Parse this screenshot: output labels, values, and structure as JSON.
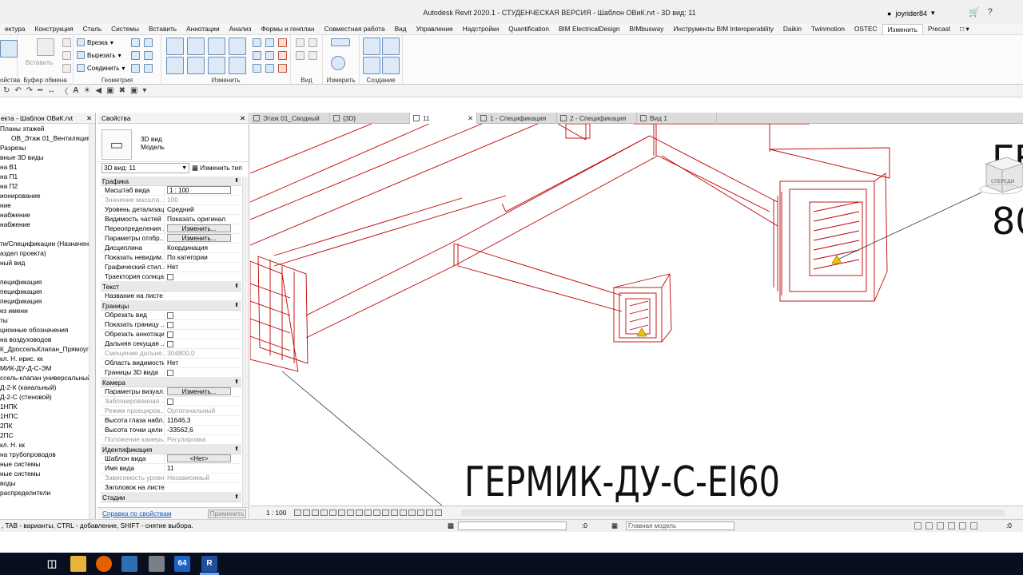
{
  "window": {
    "title": "Autodesk Revit 2020.1 - СТУДЕНЧЕСКАЯ ВЕРСИЯ - Шаблон ОВиК.rvt - 3D вид: 11",
    "user": "joyrider84"
  },
  "ribbon": {
    "tabs": [
      "ектура",
      "Конструкция",
      "Сталь",
      "Системы",
      "Вставить",
      "Аннотации",
      "Анализ",
      "Формы и генплан",
      "Совместная работа",
      "Вид",
      "Управление",
      "Надстройки",
      "Quantification",
      "BIM ElectricalDesign",
      "BIMbusway",
      "Инструменты BIM Interoperability",
      "Daikin",
      "Twinmotion",
      "OSTEC",
      "Изменить",
      "Precast"
    ],
    "active_tab": "Изменить",
    "panels": {
      "properties_label": "ойства",
      "clipboard": {
        "label": "Буфер обмена",
        "paste": "Вставить"
      },
      "geometry": {
        "label": "Геометрия",
        "cut": "Врезка",
        "cutout": "Вырезать",
        "join": "Соединить"
      },
      "modify": {
        "label": "Изменить"
      },
      "view": {
        "label": "Вид"
      },
      "measure": {
        "label": "Измерить"
      },
      "create": {
        "label": "Создание"
      }
    }
  },
  "browser": {
    "title": "екта - Шаблон ОВиК.rvt",
    "items": [
      "Планы этажей",
      "ОВ_Этаж 01_Вентиляция",
      "Разрезы",
      "вные 3D виды",
      "на В1",
      "на П1",
      "на П2",
      "ионирование",
      "ние",
      "набжение",
      "набжение",
      "",
      "ти/Спецификации (Назначение",
      "аздел проекта)",
      "ный вид",
      "",
      "пецификация",
      "пецификация",
      "пецификация",
      "ез имени",
      "ты",
      "ционные обозначения",
      "на воздуховодов",
      "К_ДроссельКлапан_Прямоугол",
      "кл. Н. ирис. кк",
      "МИК-ДУ-Д-С-ЭМ",
      "ссель-клапан универсальный в",
      "Д-2-К (канальный)",
      "Д-2-С (стеновой)",
      "1НПК",
      "1НПС",
      "2ПК",
      "2ПС",
      "кл. Н. кк",
      "на трубопроводов",
      "ные системы",
      "ные системы",
      "воды",
      "распределители"
    ]
  },
  "properties": {
    "title": "Свойства",
    "type_line1": "3D вид",
    "type_line2": "Модель",
    "selector": "3D вид: 11",
    "edit_type": "Изменить тип",
    "rows": [
      {
        "section": "Графика"
      },
      {
        "k": "Масштаб вида",
        "v": "1 : 100",
        "input": true
      },
      {
        "k": "Значение масшта...",
        "v": "100",
        "dis": true
      },
      {
        "k": "Уровень детализац...",
        "v": "Средний"
      },
      {
        "k": "Видимость частей",
        "v": "Показать оригинал"
      },
      {
        "k": "Переопределения ...",
        "v": "Изменить...",
        "btn": true
      },
      {
        "k": "Параметры отобр...",
        "v": "Изменить...",
        "btn": true
      },
      {
        "k": "Дисциплина",
        "v": "Координация"
      },
      {
        "k": "Показать невидим...",
        "v": "По категории"
      },
      {
        "k": "Графический стил...",
        "v": "Нет"
      },
      {
        "k": "Траектория солнца",
        "chk": true
      },
      {
        "section": "Текст"
      },
      {
        "k": "Название на листе",
        "v": ""
      },
      {
        "section": "Границы"
      },
      {
        "k": "Обрезать вид",
        "chk": true
      },
      {
        "k": "Показать границу ...",
        "chk": true
      },
      {
        "k": "Обрезать аннотации",
        "chk": true
      },
      {
        "k": "Дальняя секущая ...",
        "chk": true
      },
      {
        "k": "Смещение дальне...",
        "v": "304800,0",
        "dis": true
      },
      {
        "k": "Область видимости",
        "v": "Нет"
      },
      {
        "k": "Границы 3D вида",
        "chk": true
      },
      {
        "section": "Камера"
      },
      {
        "k": "Параметры визуал...",
        "v": "Изменить...",
        "btn": true
      },
      {
        "k": "Заблокированная ...",
        "chk": true,
        "dis": true
      },
      {
        "k": "Режим проециров...",
        "v": "Ортогональный",
        "dis": true
      },
      {
        "k": "Высота глаза набл...",
        "v": "11646,3"
      },
      {
        "k": "Высота точки цели",
        "v": "-33562,6"
      },
      {
        "k": "Положение камеры",
        "v": "Регулировка",
        "dis": true
      },
      {
        "section": "Идентификация"
      },
      {
        "k": "Шаблон вида",
        "v": "<Нет>",
        "btn": true
      },
      {
        "k": "Имя вида",
        "v": "11"
      },
      {
        "k": "Зависимость уровня",
        "v": "Независимый",
        "dis": true
      },
      {
        "k": "Заголовок на листе",
        "v": ""
      },
      {
        "section": "Стадии"
      }
    ],
    "help_link": "Справка по свойствам",
    "apply": "Применить"
  },
  "view_tabs": [
    {
      "label": "Этаж 01_Сводный"
    },
    {
      "label": "{3D}"
    },
    {
      "label": "11",
      "active": true
    },
    {
      "label": "1 - Спецификация"
    },
    {
      "label": "2 - Спецификация"
    },
    {
      "label": "Вид 1"
    }
  ],
  "canvas": {
    "tag_main": "ГЕРМИК-ДУ-С-EI60",
    "tag_partial_top": "ГЕ",
    "tag_partial_bottom": "80",
    "cube_label": "СПЕРЕДИ",
    "line_color": "#c00000"
  },
  "view_bar": {
    "scale": "1 : 100"
  },
  "status": {
    "message": ", TAB - варианты, CTRL - добавление, SHIFT - снятие выбора.",
    "count": ":0",
    "model": "Главная модель",
    "filter": ":0"
  },
  "taskbar": {
    "items": [
      "task-view-icon",
      "explorer-icon",
      "firefox-icon",
      "app-icon",
      "app-icon",
      "revit-64-icon",
      "revit-icon"
    ],
    "revit_64_label": "64",
    "revit_label": "R"
  }
}
